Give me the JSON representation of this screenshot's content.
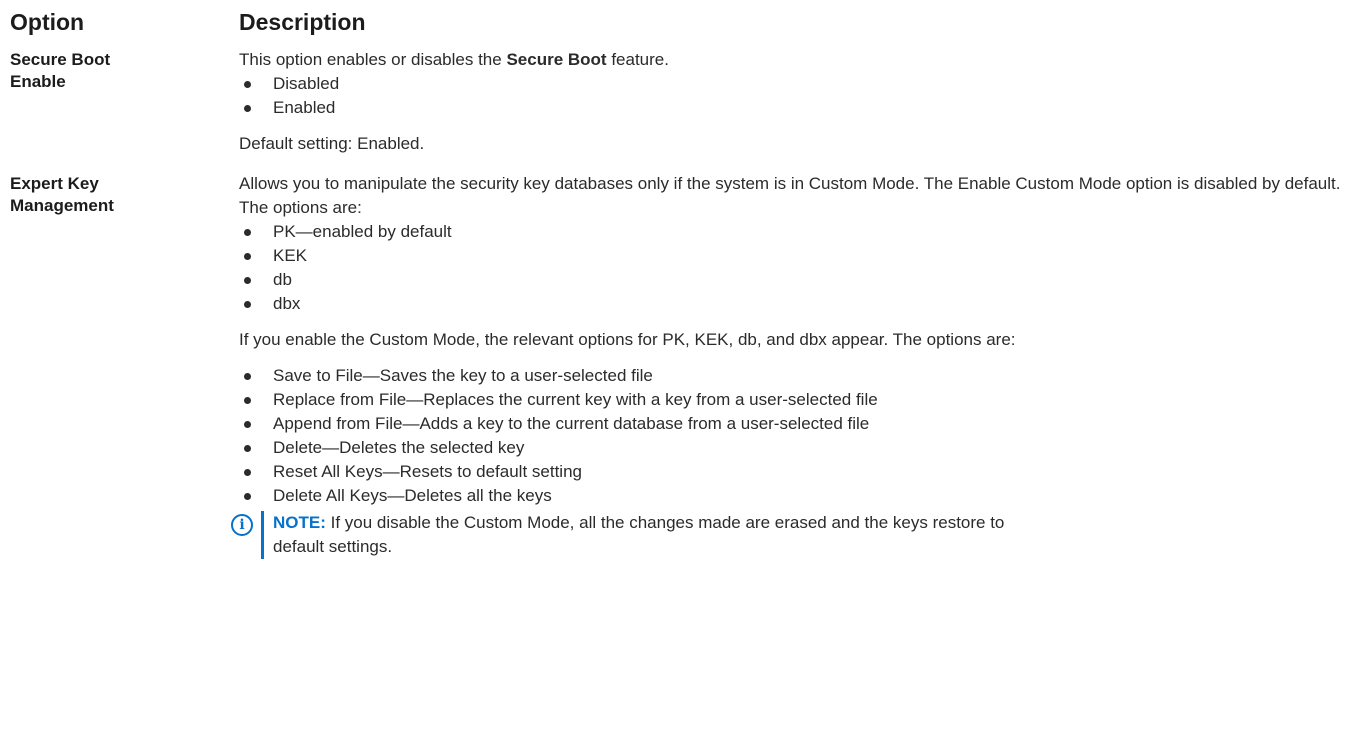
{
  "header": {
    "option": "Option",
    "description": "Description"
  },
  "rows": [
    {
      "option_line1": "Secure Boot",
      "option_line2": "Enable",
      "intro_prefix": "This option enables or disables the ",
      "intro_bold": "Secure Boot",
      "intro_suffix": " feature.",
      "bullets": [
        "Disabled",
        "Enabled"
      ],
      "default": "Default setting: Enabled."
    },
    {
      "option_line1": "Expert Key",
      "option_line2": "Management",
      "intro": "Allows you to manipulate the security key databases only if the system is in Custom Mode. The Enable Custom Mode option is disabled by default. The options are:",
      "bullets": [
        "PK—enabled by default",
        "KEK",
        "db",
        "dbx"
      ],
      "custom_intro": "If you enable the Custom Mode, the relevant options for PK, KEK, db, and dbx appear. The options are:",
      "custom_bullets": [
        "Save to File—Saves the key to a user-selected file",
        "Replace from File—Replaces the current key with a key from a user-selected file",
        "Append from File—Adds a key to the current database from a user-selected file",
        "Delete—Deletes the selected key",
        "Reset All Keys—Resets to default setting",
        "Delete All Keys—Deletes all the keys"
      ],
      "note_label": "NOTE:",
      "note_line1": " If you disable the Custom Mode, all the changes made are erased and the keys restore to",
      "note_line2": "default settings."
    }
  ],
  "colors": {
    "note_accent": "#0672cb",
    "text": "#2b2b2b"
  },
  "icons": {
    "note": "info-circle-icon"
  }
}
